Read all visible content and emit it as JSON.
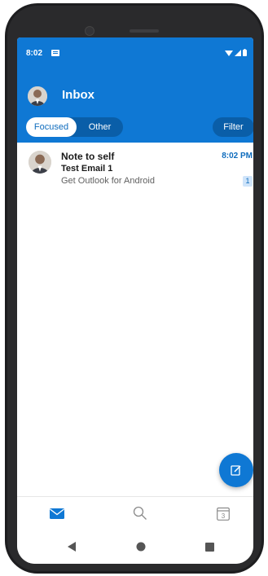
{
  "status_bar": {
    "time": "8:02"
  },
  "header": {
    "title": "Inbox"
  },
  "tabs": {
    "focused": "Focused",
    "other": "Other",
    "filter": "Filter"
  },
  "messages": [
    {
      "sender": "Note to self",
      "subject": "Test Email 1",
      "preview": "Get Outlook for Android",
      "time": "8:02 PM",
      "count": "1"
    }
  ],
  "bottom_nav": {
    "calendar_day": "3"
  },
  "colors": {
    "accent": "#0f78d4",
    "segment_bg": "#0a5ea8",
    "time_blue": "#0f6cbd",
    "badge_bg": "#cfe4fa"
  }
}
